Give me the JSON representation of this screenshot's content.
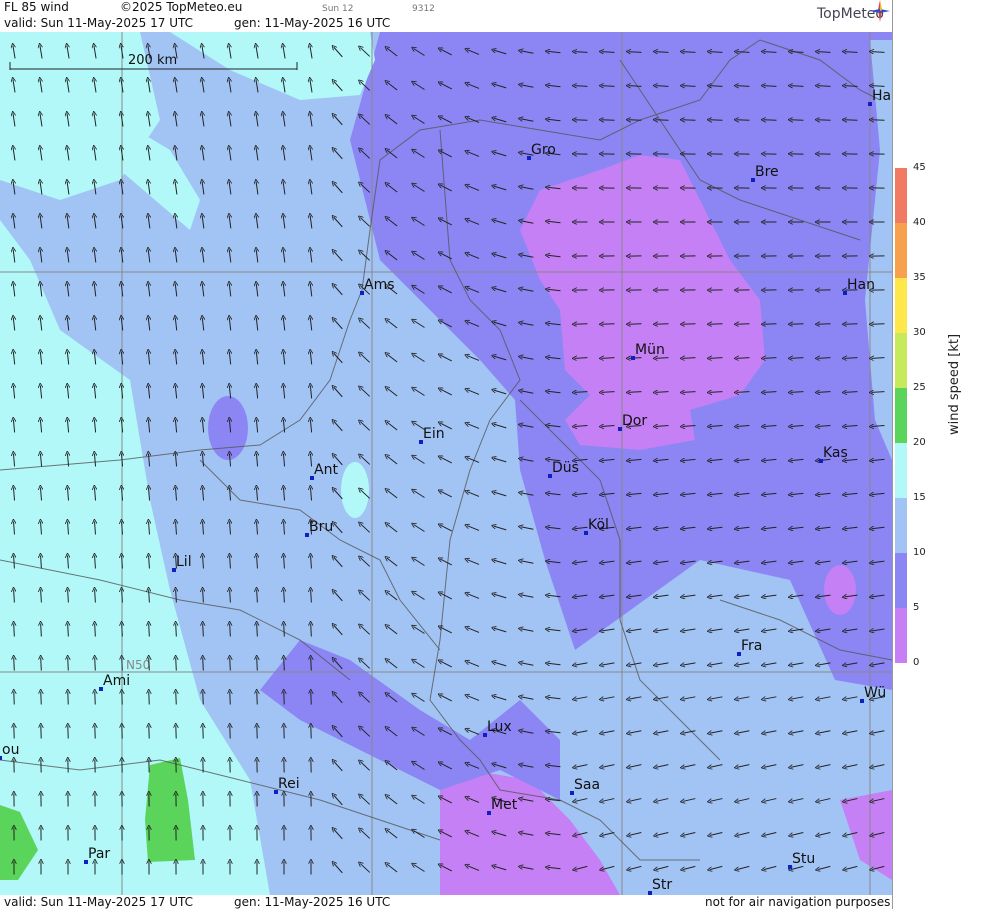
{
  "header": {
    "product": "FL 85 wind",
    "copyright": "©2025 TopMeteo.eu",
    "sun": "Sun 12",
    "code": "9312",
    "valid": "valid:  Sun  11-May-2025  17 UTC",
    "generated": "gen: 11-May-2025 16 UTC",
    "logo": "TopMeteo"
  },
  "footer": {
    "valid": "valid:  Sun  11-May-2025  17 UTC",
    "generated": "gen: 11-May-2025 16 UTC",
    "disclaimer": "not for air navigation purposes"
  },
  "map": {
    "scale_label": "200 km",
    "lat_label": "N50",
    "cities": [
      "Ha",
      "Gro",
      "Bre",
      "Ams",
      "Han",
      "Mün",
      "Dor",
      "Ein",
      "Kas",
      "Ant",
      "Düs",
      "Bru",
      "Köl",
      "Lil",
      "Fra",
      "Ami",
      "Wü",
      "Lux",
      "ou",
      "Rei",
      "Saa",
      "Met",
      "Par",
      "Stu",
      "Str"
    ]
  },
  "legend": {
    "title": "wind speed [kt]",
    "ticks": [
      "45",
      "40",
      "35",
      "30",
      "25",
      "20",
      "15",
      "10",
      "5",
      "0"
    ],
    "colors": [
      "#f07a62",
      "#f7a14e",
      "#fde74a",
      "#c5ea5c",
      "#5ad45a",
      "#b2f8f8",
      "#a2c4f4",
      "#8b86f4",
      "#c480f4"
    ]
  }
}
